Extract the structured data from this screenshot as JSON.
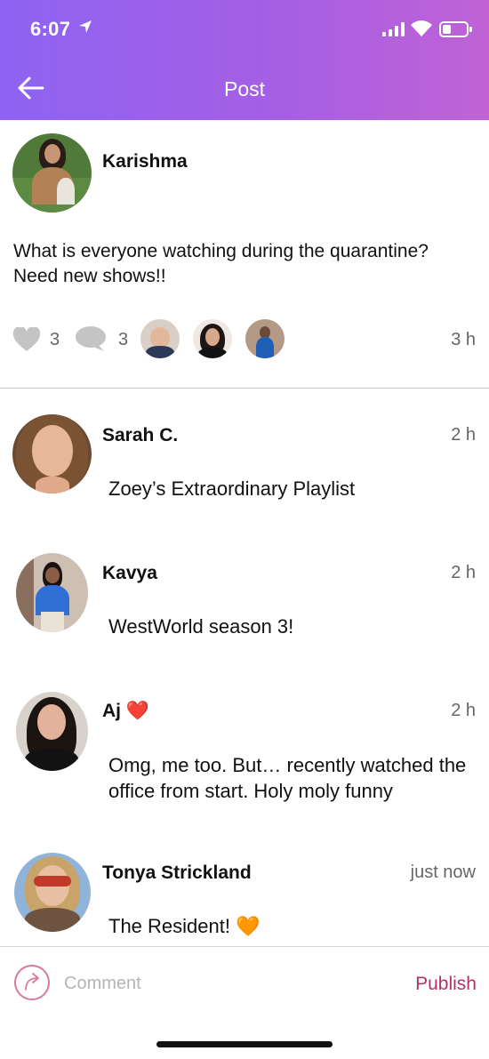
{
  "status_bar": {
    "time": "6:07"
  },
  "header": {
    "title": "Post"
  },
  "post": {
    "author": "Karishma",
    "text": "What is everyone watching during the quarantine? Need new shows!!",
    "likes": "3",
    "comments": "3",
    "time": "3 h"
  },
  "comments": [
    {
      "name": "Sarah C.",
      "time": "2 h",
      "text": "Zoey’s Extraordinary Playlist"
    },
    {
      "name": "Kavya",
      "time": "2 h",
      "text": "WestWorld season 3!"
    },
    {
      "name": "Aj ❤️",
      "time": "2 h",
      "text": "Omg, me too.  But… recently watched the office from start.  Holy moly funny"
    },
    {
      "name": "Tonya Strickland",
      "time": "just now",
      "text": "The Resident! 🧡"
    }
  ],
  "comment_bar": {
    "placeholder": "Comment",
    "publish_label": "Publish"
  },
  "icons": {
    "back": "arrow-left-icon",
    "like": "heart-icon",
    "comment": "speech-bubble-icon",
    "share": "share-arrow-icon"
  },
  "colors": {
    "header_gradient_start": "#8e63f2",
    "header_gradient_end": "#c062d6",
    "publish": "#b3316b",
    "icon_gray": "#c4c4c4"
  }
}
